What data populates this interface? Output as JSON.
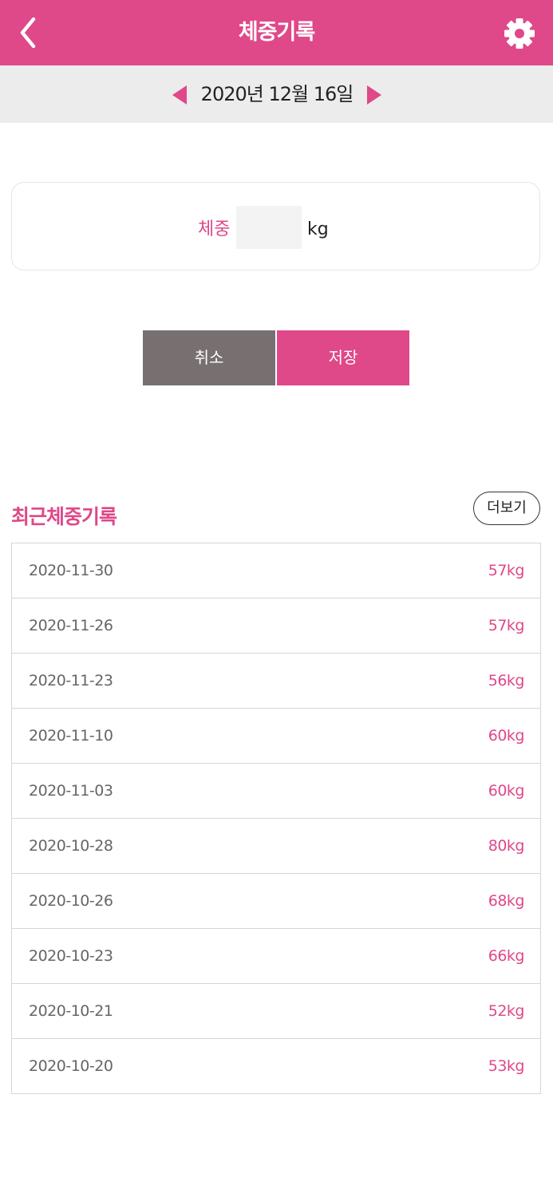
{
  "header": {
    "title": "체중기록",
    "accent_color": "#df4889",
    "back_icon": "chevron-left-icon",
    "settings_icon": "gear-icon"
  },
  "date_nav": {
    "date": "2020년 12월 16일",
    "prev_icon": "triangle-left-icon",
    "next_icon": "triangle-right-icon"
  },
  "weight_form": {
    "label": "체중",
    "value": "",
    "unit": "kg"
  },
  "buttons": {
    "cancel": "취소",
    "save": "저장"
  },
  "recent": {
    "title": "최근체중기록",
    "more_label": "더보기",
    "records": [
      {
        "date": "2020-11-30",
        "weight": "57kg"
      },
      {
        "date": "2020-11-26",
        "weight": "57kg"
      },
      {
        "date": "2020-11-23",
        "weight": "56kg"
      },
      {
        "date": "2020-11-10",
        "weight": "60kg"
      },
      {
        "date": "2020-11-03",
        "weight": "60kg"
      },
      {
        "date": "2020-10-28",
        "weight": "80kg"
      },
      {
        "date": "2020-10-26",
        "weight": "68kg"
      },
      {
        "date": "2020-10-23",
        "weight": "66kg"
      },
      {
        "date": "2020-10-21",
        "weight": "52kg"
      },
      {
        "date": "2020-10-20",
        "weight": "53kg"
      }
    ]
  }
}
